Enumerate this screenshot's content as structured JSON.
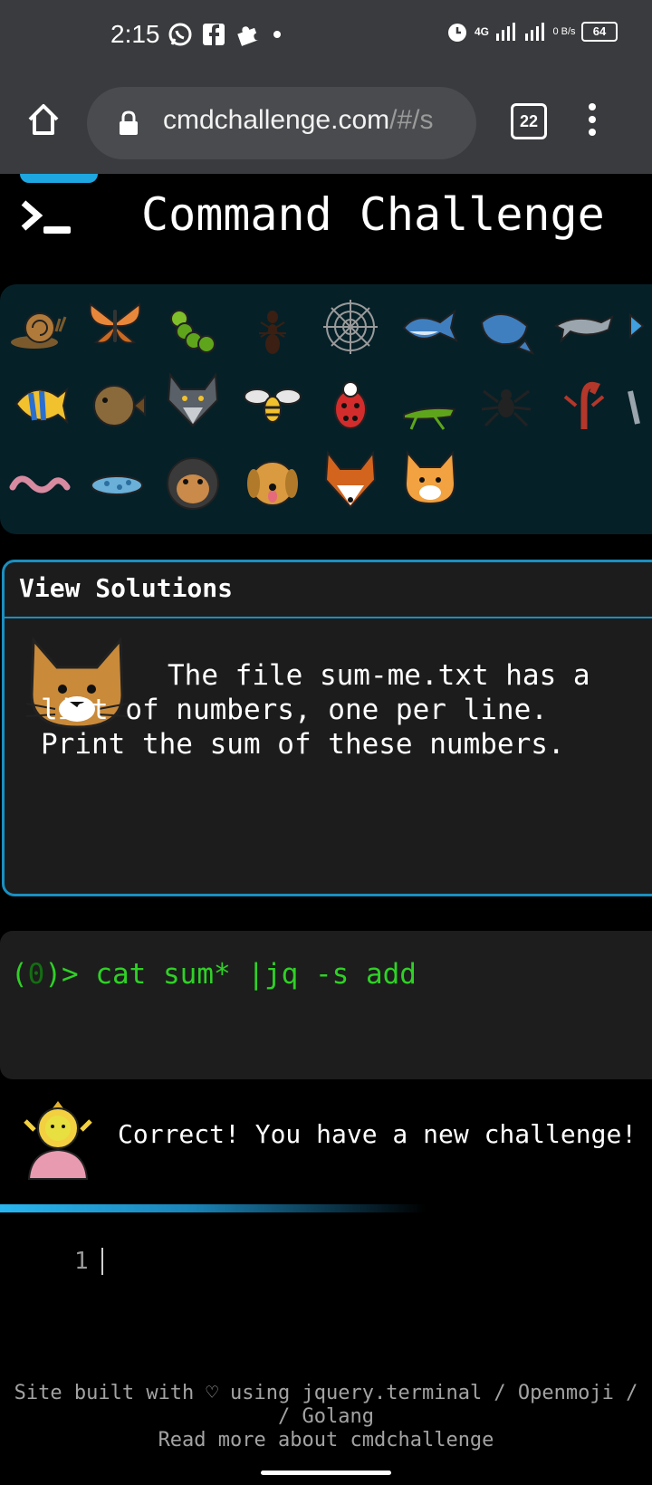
{
  "status_bar": {
    "time": "2:15",
    "network": "4G",
    "data_rate": "0 B/s",
    "battery": "64"
  },
  "browser": {
    "url_main": "cmdchallenge.com",
    "url_rest": "/#/s",
    "tab_count": "22"
  },
  "page": {
    "title": "Command Challenge",
    "emoji_icons": [
      "snail",
      "butterfly",
      "caterpillar",
      "ant",
      "spider-web",
      "whale",
      "spouting-whale",
      "dolphin",
      "fish-partial",
      "tropical-fish",
      "blowfish",
      "wolf",
      "honeybee",
      "lady-beetle",
      "cricket",
      "spider",
      "scorpion",
      "partial",
      "worm",
      "microbe",
      "gorilla",
      "dog-face",
      "fox",
      "cat-face"
    ],
    "solutions_title": "View Solutions",
    "challenge_text": "The file sum-me.txt has a list of numbers, one per line. Print the sum of these numbers.",
    "terminal": {
      "prompt_open": "(",
      "prompt_count": "0",
      "prompt_close": ")> ",
      "command": "cat sum* |jq -s add"
    },
    "result_text": "Correct! You have a new challenge!",
    "editor": {
      "line_number": "1"
    },
    "footer": {
      "line1": "Site built with ♡ using jquery.terminal / Openmoji /",
      "line2": "/ Golang",
      "line3": "Read more about cmdchallenge"
    }
  },
  "colors": {
    "accent": "#1a8fc0",
    "command_green": "#2fd126",
    "emoji_panel": "#062028"
  }
}
